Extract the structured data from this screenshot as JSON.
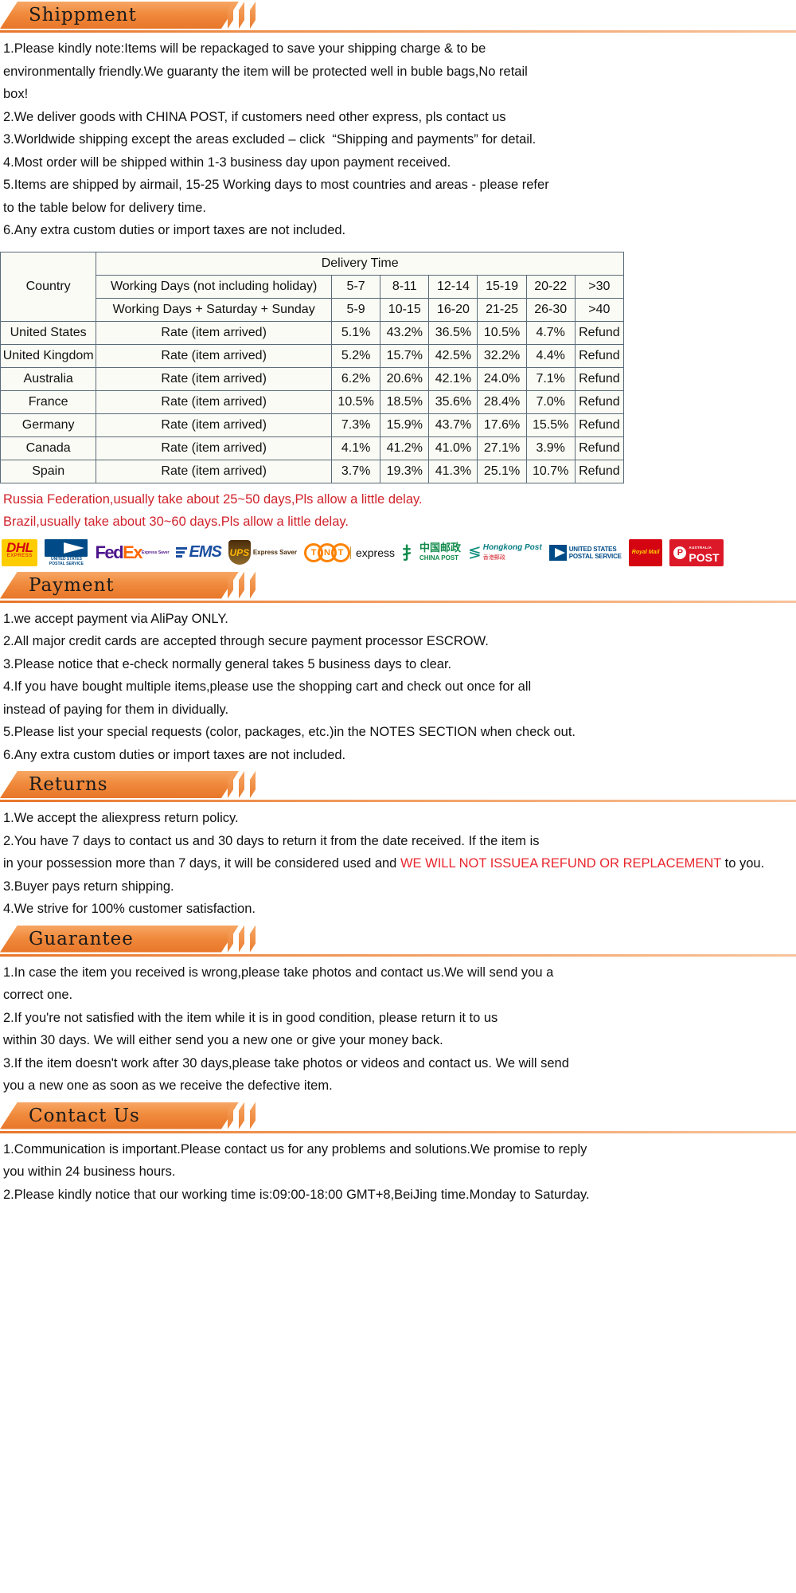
{
  "sections": {
    "shipment": {
      "title": "Shippment",
      "lines": [
        "1.Please kindly note:Items will be repackaged to save your shipping charge & to be\nenvironmentally friendly.We guaranty the item will be protected well in buble bags,No retail\nbox!",
        "2.We deliver goods with CHINA POST, if customers need other express, pls contact us",
        "3.Worldwide shipping except the areas excluded – click  “Shipping and payments” for detail.",
        "4.Most order will be shipped within 1-3 business day upon payment received.",
        "5.Items are shipped by airmail, 15-25 Working days to most countries and areas - please refer\nto the table below for delivery time.",
        "6.Any extra custom duties or import taxes are not included."
      ],
      "notes": [
        "Russia Federation,usually take about 25~50 days,Pls allow a little delay.",
        "Brazil,usually take about 30~60 days.Pls allow a little delay."
      ]
    },
    "payment": {
      "title": "Payment",
      "lines": [
        "1.we accept payment via AliPay ONLY.",
        "2.All major credit cards are accepted through secure payment processor ESCROW.",
        "3.Please notice that e-check normally general takes 5 business days to clear.",
        "4.If you have bought multiple items,please use the shopping cart and check out once for all\ninstead of paying for them in dividually.",
        "5.Please list your special requests (color, packages, etc.)in the NOTES SECTION when check out.",
        "6.Any extra custom duties or import taxes are not included."
      ]
    },
    "returns": {
      "title": "Returns",
      "line1": "1.We accept the aliexpress return policy.",
      "line2_a": "2.You have 7 days to contact us and 30 days to return it from the date received. If the item is\nin your possession more than 7 days, it will be considered used and ",
      "line2_red": "WE WILL NOT ISSUEA REFUND OR REPLACEMENT",
      "line2_b": " to you.",
      "line3": "3.Buyer pays return shipping.",
      "line4": "4.We strive for 100% customer satisfaction."
    },
    "guarantee": {
      "title": "Guarantee",
      "lines": [
        "1.In case the item you received is wrong,please take photos and contact us.We will send you a\ncorrect one.",
        "2.If you're not satisfied with the item while it is in good condition, please return it to us\nwithin 30 days. We will either send you a new one or give your money back.",
        "3.If the item doesn't work after 30 days,please take photos or videos and contact us. We will send\nyou a new one as soon as we receive the defective item."
      ]
    },
    "contact": {
      "title": "Contact Us",
      "lines": [
        "1.Communication is important.Please contact us for any problems and solutions.We promise to reply\nyou within 24 business hours.",
        "2.Please kindly notice that our working time is:09:00-18:00 GMT+8,BeiJing time.Monday to Saturday."
      ]
    }
  },
  "delivery_table": {
    "country_header": "Country",
    "delivery_time_header": "Delivery Time",
    "row_working_days_label": "Working Days (not including holiday)",
    "row_working_days_values": [
      "5-7",
      "8-11",
      "12-14",
      "15-19",
      "20-22",
      ">30"
    ],
    "row_with_weekend_label": "Working Days + Saturday + Sunday",
    "row_with_weekend_values": [
      "5-9",
      "10-15",
      "16-20",
      "21-25",
      "26-30",
      ">40"
    ],
    "rate_label": "Rate (item arrived)",
    "rows": [
      {
        "country": "United States",
        "values": [
          "5.1%",
          "43.2%",
          "36.5%",
          "10.5%",
          "4.7%",
          "Refund"
        ]
      },
      {
        "country": "United Kingdom",
        "values": [
          "5.2%",
          "15.7%",
          "42.5%",
          "32.2%",
          "4.4%",
          "Refund"
        ]
      },
      {
        "country": "Australia",
        "values": [
          "6.2%",
          "20.6%",
          "42.1%",
          "24.0%",
          "7.1%",
          "Refund"
        ]
      },
      {
        "country": "France",
        "values": [
          "10.5%",
          "18.5%",
          "35.6%",
          "28.4%",
          "7.0%",
          "Refund"
        ]
      },
      {
        "country": "Germany",
        "values": [
          "7.3%",
          "15.9%",
          "43.7%",
          "17.6%",
          "15.5%",
          "Refund"
        ]
      },
      {
        "country": "Canada",
        "values": [
          "4.1%",
          "41.2%",
          "41.0%",
          "27.1%",
          "3.9%",
          "Refund"
        ]
      },
      {
        "country": "Spain",
        "values": [
          "3.7%",
          "19.3%",
          "41.3%",
          "25.1%",
          "10.7%",
          "Refund"
        ]
      }
    ]
  },
  "carriers": [
    {
      "name": "dhl",
      "label": "DHL",
      "sub": "EXPRESS"
    },
    {
      "name": "usps-1",
      "label": "UNITED STATES",
      "sub": "POSTAL SERVICE"
    },
    {
      "name": "fedex",
      "label": "FedEx",
      "sub": "Express"
    },
    {
      "name": "ems",
      "label": "EMS",
      "sub": ""
    },
    {
      "name": "ups",
      "label": "UPS",
      "sub": "Express Saver"
    },
    {
      "name": "tnt",
      "label": "TNT",
      "sub": "express"
    },
    {
      "name": "china-post",
      "label": "中国邮政",
      "sub": "CHINA POST"
    },
    {
      "name": "hongkong-post",
      "label": "Hongkong Post",
      "sub": "香港郵政"
    },
    {
      "name": "usps-2",
      "label": "UNITED STATES",
      "sub": "POSTAL SERVICE"
    },
    {
      "name": "royal-mail",
      "label": "Royal Mail",
      "sub": ""
    },
    {
      "name": "australia-post",
      "label": "POST",
      "sub": "AUSTRALIA"
    }
  ],
  "colors": {
    "banner_orange": "#e8762a",
    "banner_light": "#f7a765",
    "red_note": "#d0232b",
    "table_border": "#5a6b78"
  }
}
